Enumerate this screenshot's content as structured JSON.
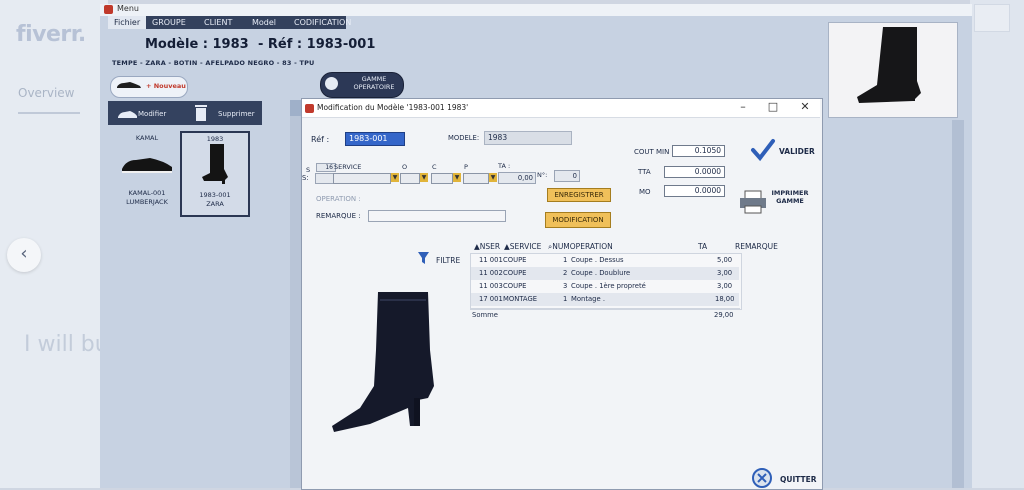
{
  "background": {
    "logo": "fiverr.",
    "overview_tab": "Overview",
    "gig_title_fragment": "I will bu"
  },
  "app": {
    "title": "Menu",
    "menu": [
      {
        "label": "Fichier"
      },
      {
        "label": "GROUPE"
      },
      {
        "label": "CLIENT"
      },
      {
        "label": "Model"
      }
    ],
    "tab": "CODIFICATION",
    "header": {
      "model_label": "Modèle : 1983",
      "ref_label": "- Réf : 1983-001",
      "description": "TEMPE - ZARA - BOTIN - AFELPADO NEGRO - 83 - TPU"
    },
    "nouveau_label": "+ Nouveau",
    "gamme_label": "GAMME OPERATOIRE",
    "toolbar": {
      "modifier": "Modifier",
      "supprimer": "Supprimer"
    },
    "cards": [
      {
        "title": "KAMAL",
        "code": "KAMAL-001",
        "brand": "LUMBERJACK"
      },
      {
        "title": "1983",
        "code": "1983-001",
        "brand": "ZARA"
      }
    ]
  },
  "dialog": {
    "title": "Modification du Modèle '1983-001 1983'",
    "ref_label": "Réf :",
    "ref_value": "1983-001",
    "modele_label": "MODELE:",
    "modele_value": "1983",
    "s_label": "S:",
    "s_top": "S",
    "s_value": "16",
    "service_label": "SERVICE",
    "o_label": "O",
    "c_label": "C",
    "p_label": "P",
    "ta_label": "TA :",
    "ta_value": "0,00",
    "n_label": "N°:",
    "n_value": "0",
    "operation_label": "OPERATION :",
    "remarque_label": "REMARQUE :",
    "enregistrer": "ENREGISTRER",
    "modification": "MODIFICATION",
    "cout_min_label": "COUT MIN",
    "cout_min_value": "0.1050",
    "tta_label": "TTA",
    "tta_value": "0.0000",
    "mo_label": "MO",
    "mo_value": "0.0000",
    "valider": "VALIDER",
    "imprimer": "IMPRIMER GAMME",
    "filtre": "FILTRE",
    "grid": {
      "headers": [
        "NSER",
        "SERVICE",
        "NUMOPERATION",
        "TA",
        "REMARQUE"
      ],
      "rows": [
        {
          "nser": "11 001",
          "service": "COUPE",
          "num": "1",
          "op": "Coupe . Dessus",
          "ta": "5,00"
        },
        {
          "nser": "11 002",
          "service": "COUPE",
          "num": "2",
          "op": "Coupe . Doublure",
          "ta": "3,00"
        },
        {
          "nser": "11 003",
          "service": "COUPE",
          "num": "3",
          "op": "Coupe . 1ère propreté",
          "ta": "3,00"
        },
        {
          "nser": "17 001",
          "service": "MONTAGE",
          "num": "1",
          "op": "Montage .",
          "ta": "18,00"
        }
      ],
      "somme_label": "Somme",
      "somme_value": "29,00"
    },
    "quitter": "QUITTER"
  }
}
